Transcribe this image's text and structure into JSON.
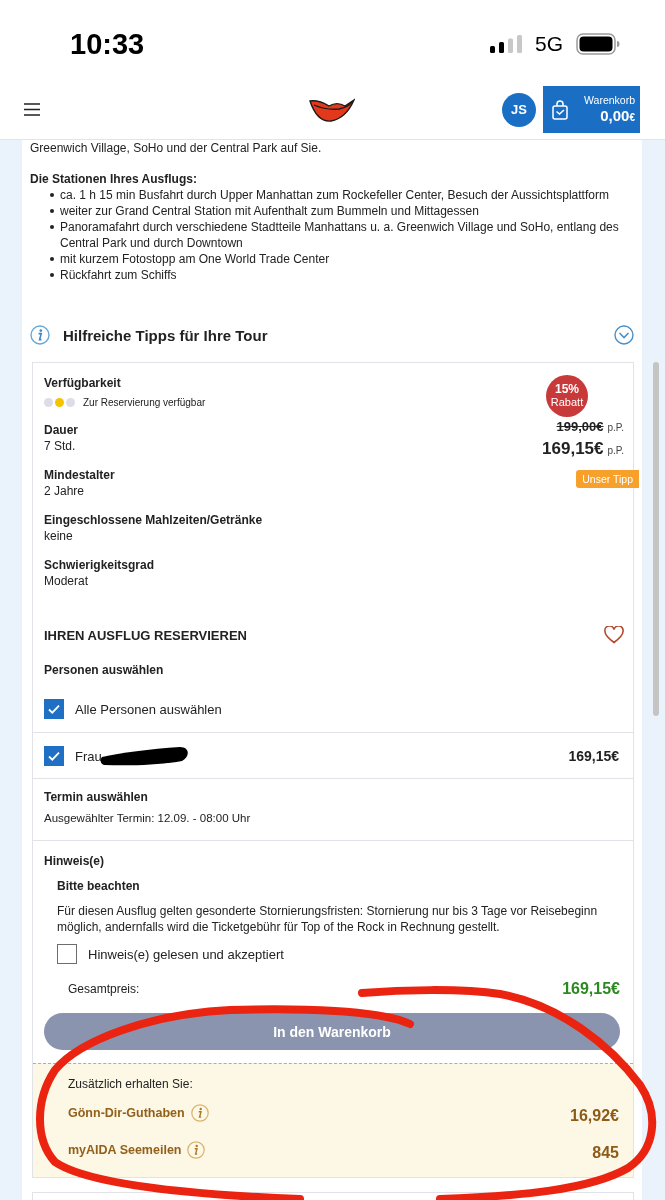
{
  "status_bar": {
    "time": "10:33",
    "network": "5G"
  },
  "header": {
    "avatar": "JS",
    "cart": {
      "label": "Warenkorb",
      "amount": "0,00",
      "currency": "€"
    }
  },
  "description": {
    "intro": "Greenwich Village, SoHo und der Central Park auf Sie.",
    "stations_heading": "Die Stationen Ihres Ausflugs:",
    "stations": [
      "ca. 1 h 15 min Busfahrt durch Upper Manhattan zum Rockefeller Center, Besuch der Aussichtsplattform",
      "weiter zur Grand Central Station mit Aufenthalt zum Bummeln und Mittagessen",
      "Panoramafahrt durch verschiedene Stadtteile Manhattans u. a. Greenwich Village und SoHo, entlang des Central Park und durch Downtown",
      "mit kurzem Fotostopp am One World Trade Center",
      "Rückfahrt zum Schiffs"
    ]
  },
  "tips": {
    "title": "Hilfreiche Tipps für Ihre Tour",
    "expanded": false
  },
  "details": {
    "availability": {
      "label": "Verfügbarkeit",
      "dots": [
        {
          "color": "#dcdde6"
        },
        {
          "color": "#f5c400"
        },
        {
          "color": "#dcdde6"
        }
      ],
      "text": "Zur Reservierung verfügbar"
    },
    "facts": [
      {
        "label": "Dauer",
        "value": "7 Std."
      },
      {
        "label": "Mindestalter",
        "value": "2 Jahre"
      },
      {
        "label": "Eingeschlossene Mahlzeiten/Getränke",
        "value": "keine"
      },
      {
        "label": "Schwierigkeitsgrad",
        "value": "Moderat"
      }
    ]
  },
  "price": {
    "discount": "15%",
    "discount_label": "Rabatt",
    "old_price": "199,00€",
    "old_unit": "p.P.",
    "price": "169,15€",
    "unit": "p.P.",
    "tag": "Unser Tipp"
  },
  "reservation": {
    "title": "IHREN AUSFLUG RESERVIEREN",
    "favorite": false,
    "persons_heading": "Personen auswählen",
    "select_all": {
      "label": "Alle Personen auswählen",
      "checked": true
    },
    "persons": [
      {
        "name": "Frau",
        "redacted": true,
        "price": "169,15€",
        "checked": true
      }
    ],
    "date_heading": "Termin auswählen",
    "date": "Ausgewählter Termin: 12.09. - 08:00 Uhr"
  },
  "notes": {
    "heading": "Hinweis(e)",
    "subheading": "Bitte beachten",
    "text": "Für diesen Ausflug gelten gesonderte Stornierungsfristen: Stornierung nur bis 3 Tage vor Reisebeginn möglich, andernfalls wird die Ticketgebühr für Top of the Rock in Rechnung gestellt.",
    "accept": {
      "label": "Hinweis(e) gelesen und akzeptiert",
      "checked": false
    }
  },
  "total": {
    "label": "Gesamtpreis:",
    "value": "169,15€"
  },
  "cart_button": {
    "label": "In den Warenkorb",
    "disabled": true
  },
  "bonus": {
    "heading": "Zusätzlich erhalten Sie:",
    "items": [
      {
        "label": "Gönn-Dir-Guthaben",
        "value": "16,92€"
      },
      {
        "label": "myAIDA Seemeilen",
        "value": "845"
      }
    ]
  }
}
